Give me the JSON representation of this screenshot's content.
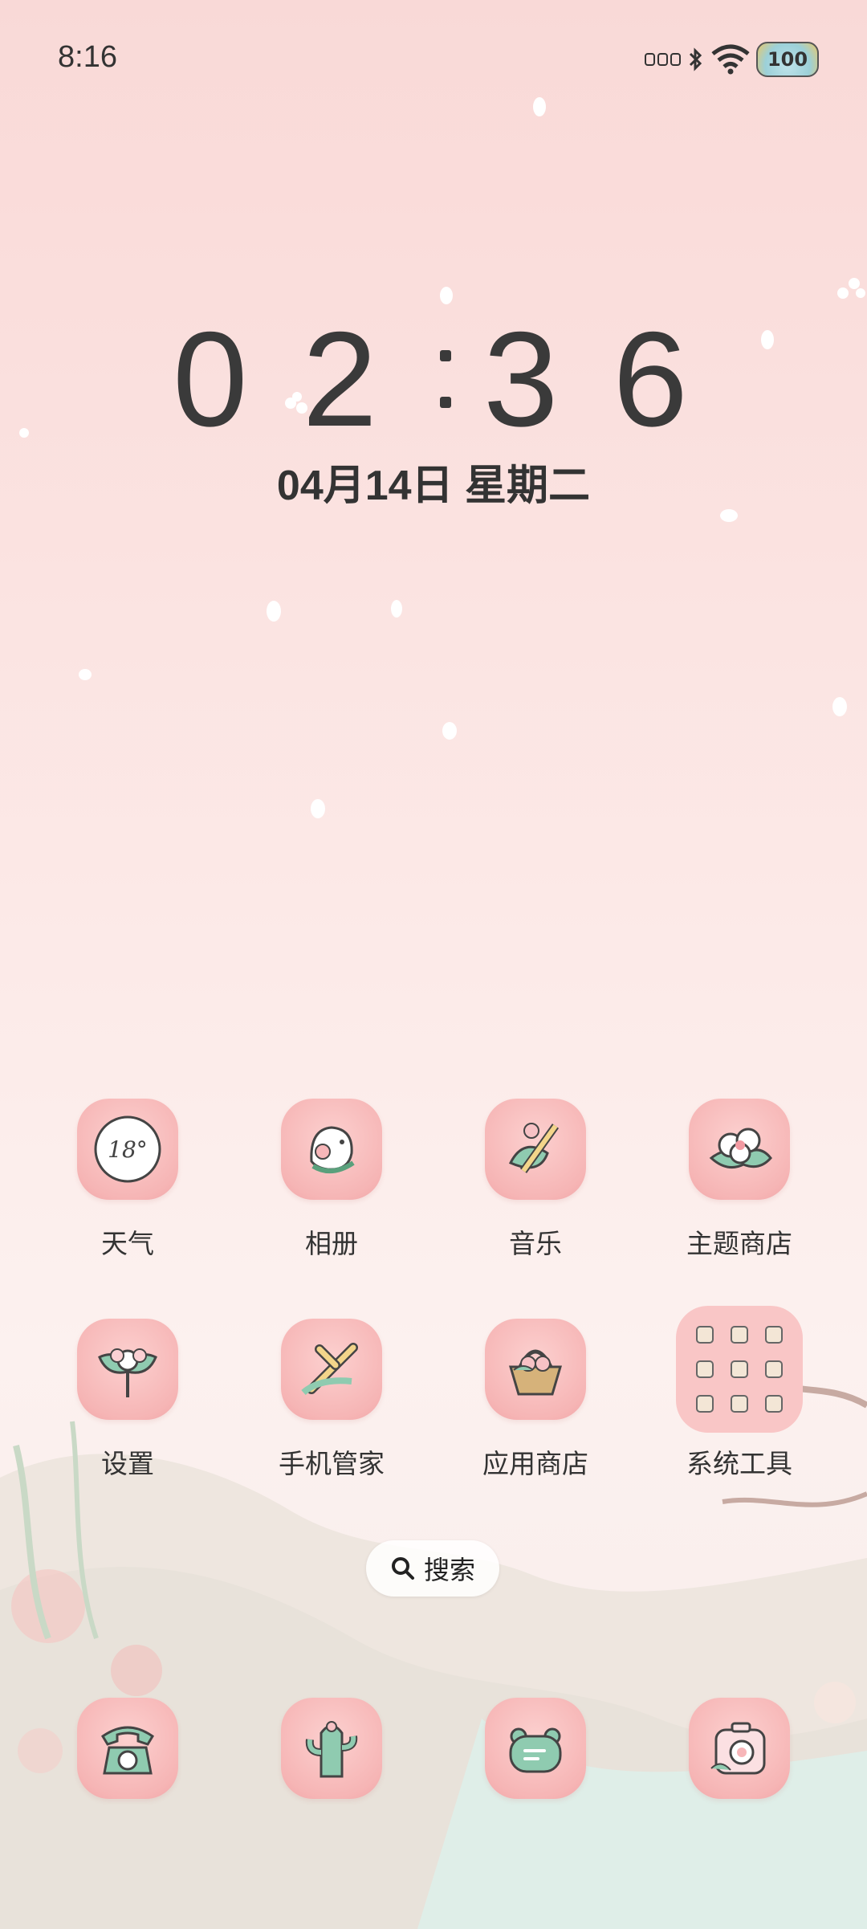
{
  "status_bar": {
    "time": "8:16",
    "battery": "100"
  },
  "lock_clock": {
    "h1": "0",
    "h2": "2",
    "m1": "3",
    "m2": "6",
    "date": "04月14日 星期二"
  },
  "apps": [
    {
      "label": "天气",
      "icon": "weather-icon",
      "temp": "18°"
    },
    {
      "label": "相册",
      "icon": "gallery-icon"
    },
    {
      "label": "音乐",
      "icon": "music-icon"
    },
    {
      "label": "主题商店",
      "icon": "theme-store-icon"
    },
    {
      "label": "设置",
      "icon": "settings-icon"
    },
    {
      "label": "手机管家",
      "icon": "phone-manager-icon"
    },
    {
      "label": "应用商店",
      "icon": "app-store-icon"
    },
    {
      "label": "系统工具",
      "icon": "system-tools-folder"
    }
  ],
  "search": {
    "label": "搜索"
  },
  "dock": [
    {
      "icon": "phone-icon"
    },
    {
      "icon": "cactus-icon"
    },
    {
      "icon": "messages-icon"
    },
    {
      "icon": "camera-icon"
    }
  ],
  "colors": {
    "icon_bg": "#f6b5b5",
    "background_top": "#f9d9d7",
    "accent_green": "#8fcbb0"
  }
}
